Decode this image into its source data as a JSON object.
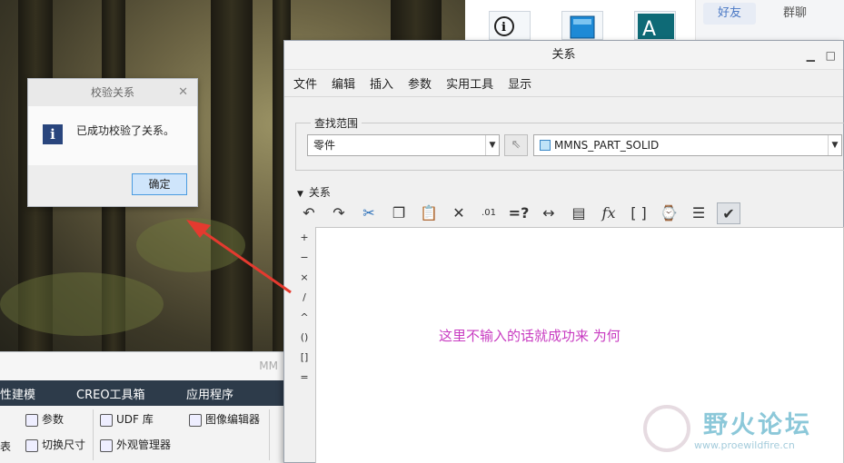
{
  "im_tabs": {
    "active": "好友",
    "other": "群聊"
  },
  "relations_window": {
    "title": "关系",
    "controls": [
      "▁",
      "□"
    ],
    "menu": [
      "文件",
      "编辑",
      "插入",
      "参数",
      "实用工具",
      "显示"
    ],
    "scope_label": "查找范围",
    "scope_type": "零件",
    "model_name": "MMNS_PART_SOLID",
    "section_label": "关系",
    "side_operators": [
      "+",
      "−",
      "×",
      "/",
      "^",
      "()",
      "[]",
      "="
    ],
    "editor_note": "这里不输入的话就成功来 为何"
  },
  "toolbar_icons": [
    "undo-icon",
    "redo-icon",
    "cut-icon",
    "copy-icon",
    "paste-icon",
    "delete-icon",
    "decimal-icon",
    "evaluate-icon",
    "dimension-icon",
    "local-params-icon",
    "function-icon",
    "brackets-icon",
    "unit-icon",
    "sort-icon",
    "verify-icon"
  ],
  "verify_dialog": {
    "title": "校验关系",
    "message": "已成功校验了关系。",
    "ok_label": "确定"
  },
  "creo_ribbon": {
    "title": "MM",
    "tabs": [
      "性建模",
      "CREO工具箱",
      "应用程序"
    ],
    "items": [
      "参数",
      "UDF 库",
      "图像编辑器",
      "切换尺寸",
      "外观管理器",
      "表"
    ]
  },
  "watermark": {
    "title": "野火论坛",
    "url": "www.proewildfire.cn"
  },
  "colors": {
    "note": "#c83bc1",
    "ribbon_tabs": "#2d3b4a",
    "arrow": "#e53a2f"
  }
}
